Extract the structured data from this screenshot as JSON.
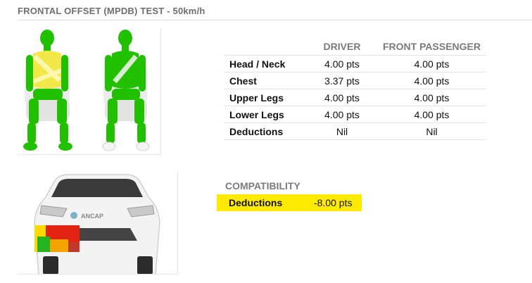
{
  "section": {
    "title": "FRONTAL OFFSET (MPDB) TEST - 50km/h"
  },
  "table": {
    "headers": [
      "",
      "DRIVER",
      "FRONT PASSENGER"
    ],
    "rows": [
      {
        "label": "Head / Neck",
        "driver": "4.00 pts",
        "passenger": "4.00 pts"
      },
      {
        "label": "Chest",
        "driver": "3.37 pts",
        "passenger": "4.00 pts"
      },
      {
        "label": "Upper Legs",
        "driver": "4.00 pts",
        "passenger": "4.00 pts"
      },
      {
        "label": "Lower Legs",
        "driver": "4.00 pts",
        "passenger": "4.00 pts"
      },
      {
        "label": "Deductions",
        "driver": "Nil",
        "passenger": "Nil"
      }
    ]
  },
  "compatibility": {
    "title": "COMPATIBILITY",
    "label": "Deductions",
    "value": "-8.00 pts",
    "highlight_color": "#ffea00"
  },
  "figures": {
    "car_badge": "ANCAP",
    "dummy_colors": {
      "good": "#21c100",
      "adequate": "#f2e84a",
      "seat": "#efefef"
    },
    "heatmap_colors": [
      "#e32412",
      "#ffd800",
      "#24b321",
      "#f5a300"
    ]
  }
}
